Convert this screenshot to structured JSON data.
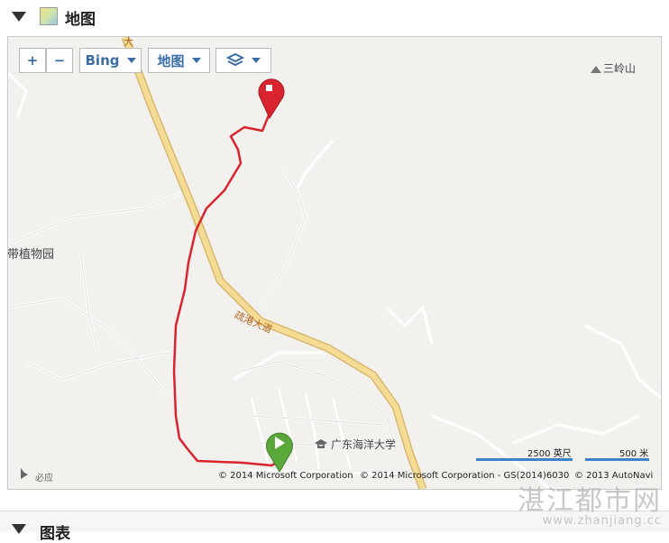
{
  "section": {
    "title": "地图"
  },
  "map": {
    "zoom_in": "+",
    "zoom_out": "−",
    "provider_label": "Bing",
    "type_label": "地图",
    "labels": {
      "mountain": "三岭山",
      "garden": "热带植物园",
      "road_top": "大",
      "road": "疏港大道",
      "university": "广东海洋大学"
    },
    "bing_logo": "必应",
    "scale": {
      "imperial": "2500 英尺",
      "metric": "500 米"
    },
    "attribution": [
      "© 2014 Microsoft Corporation",
      "© 2014 Microsoft Corporation - GS(2014)6030",
      "© 2013 AutoNavi"
    ],
    "colors": {
      "route": "#d9232e",
      "start_marker": "#5aa83a",
      "end_marker": "#d9232e",
      "highway": "#f2d48a",
      "control_text": "#3a6ea5"
    }
  },
  "next_section": {
    "title": "图表"
  },
  "watermark": {
    "main": "湛江都市网",
    "url": "www.zhanjiang.cc"
  }
}
